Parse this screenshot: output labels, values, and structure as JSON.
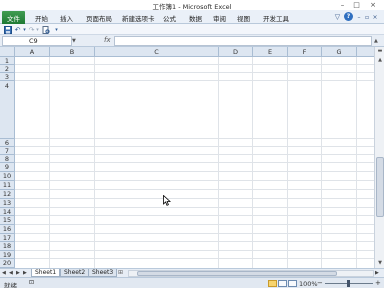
{
  "window": {
    "title": "工作簿1 - Microsoft Excel",
    "minimize_glyph": "–",
    "maximize_glyph": "□",
    "close_glyph": "×"
  },
  "ribbon": {
    "file_tab": "文件",
    "tabs": [
      "开始",
      "插入",
      "页面布局",
      "新建选项卡",
      "公式",
      "数据",
      "审阅",
      "视图",
      "开发工具"
    ],
    "help_glyph": "?"
  },
  "formula_bar": {
    "name_box": "C9",
    "fx_label": "fx",
    "formula": ""
  },
  "grid": {
    "columns": [
      "A",
      "B",
      "C",
      "D",
      "E",
      "F",
      "G"
    ],
    "rows": [
      "1",
      "2",
      "3",
      "4",
      "6",
      "7",
      "8",
      "9",
      "10",
      "11",
      "12",
      "13",
      "14",
      "15",
      "16",
      "17",
      "18",
      "19",
      "20"
    ]
  },
  "sheets": {
    "tabs": [
      "Sheet1",
      "Sheet2",
      "Sheet3"
    ],
    "active": "Sheet1"
  },
  "status": {
    "ready": "就绪",
    "zoom": "100%",
    "zoom_minus": "−",
    "zoom_plus": "+"
  },
  "colors": {
    "file_tab": "#217346",
    "header_bg": "#dde6f1",
    "grid_line": "#dfe3e8"
  }
}
